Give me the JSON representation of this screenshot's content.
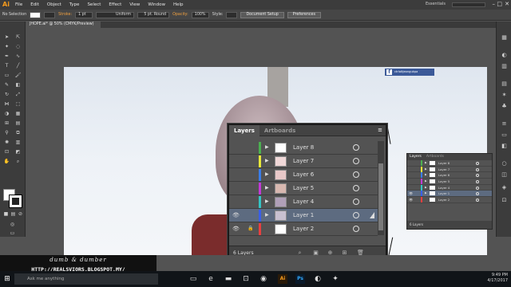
{
  "app": {
    "logo": "Ai"
  },
  "menu": [
    "File",
    "Edit",
    "Object",
    "Type",
    "Select",
    "Effect",
    "View",
    "Window",
    "Help"
  ],
  "workspace": "Essentials",
  "window_controls": {
    "minimize": "–",
    "maximize": "□",
    "close": "✕"
  },
  "control_bar": {
    "selection": "No Selection",
    "stroke_label": "Stroke:",
    "stroke_weight": "1 pt",
    "profile": "Uniform",
    "brush": "5 pt. Round",
    "opacity_label": "Opacity:",
    "opacity": "100%",
    "style_label": "Style:",
    "document_setup": "Document Setup",
    "preferences": "Preferences"
  },
  "document_tab": "JHOPE.ai* @ 50% (CMYK/Preview)",
  "watermark": "ctrlaltjeongukpa",
  "layers_panel": {
    "tabs": [
      "Layers",
      "Artboards"
    ],
    "menu_icon": "≡",
    "count": "6 Layers",
    "layers": [
      {
        "name": "Layer 8",
        "color": "#4caf50",
        "visible": false,
        "locked": false,
        "selected": false
      },
      {
        "name": "Layer 7",
        "color": "#e8e83a",
        "visible": false,
        "locked": false,
        "selected": false
      },
      {
        "name": "Layer 6",
        "color": "#3a7de8",
        "visible": false,
        "locked": false,
        "selected": false
      },
      {
        "name": "Layer 5",
        "color": "#c23ad6",
        "visible": false,
        "locked": false,
        "selected": false
      },
      {
        "name": "Layer 4",
        "color": "#35c4c4",
        "visible": false,
        "locked": false,
        "selected": false
      },
      {
        "name": "Layer 1",
        "color": "#3a5fe8",
        "visible": true,
        "locked": false,
        "selected": true
      },
      {
        "name": "Layer 2",
        "color": "#e84040",
        "visible": true,
        "locked": true,
        "selected": false
      }
    ]
  },
  "small_layers_panel": {
    "tabs": [
      "Layers",
      "Artboards"
    ],
    "count": "6 Layers"
  },
  "blog": {
    "title": "dumb & dumber",
    "url": "HTTP://REALSVIORS.BLOGSPOT.MY/"
  },
  "taskbar": {
    "search_placeholder": "Ask me anything",
    "ai_label": "Ai",
    "ps_label": "Ps",
    "time": "9:49 PM",
    "date": "4/17/2017"
  }
}
